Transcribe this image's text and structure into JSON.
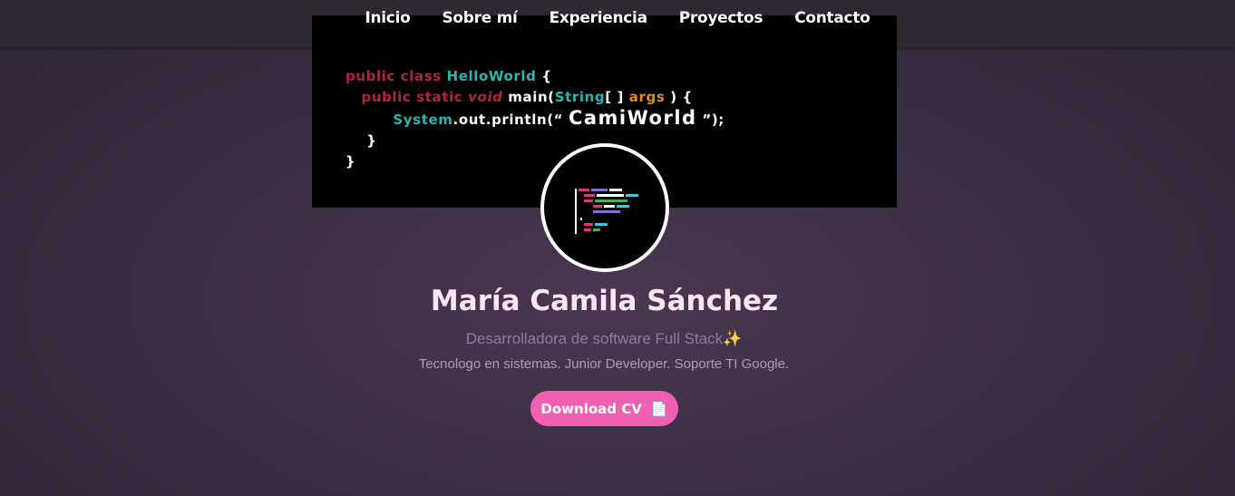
{
  "nav": {
    "items": [
      {
        "label": "Inicio"
      },
      {
        "label": "Sobre mí"
      },
      {
        "label": "Experiencia"
      },
      {
        "label": "Proyectos"
      },
      {
        "label": "Contacto"
      }
    ]
  },
  "banner": {
    "code": {
      "l1_kw": "public class ",
      "l1_cls": "HelloWorld",
      "l1_end": " {",
      "l2_kw": "public static ",
      "l2_void": "void",
      "l2_main": " main(",
      "l2_string": "String",
      "l2_brk": "[ ] ",
      "l2_args": "args",
      "l2_end": " ) {",
      "l3_system": "System",
      "l3_dot1": ".",
      "l3_out": "out",
      "l3_print": ".println(“ ",
      "l3_cami": "CamiWorld",
      "l3_end": " ”);",
      "l4": "}",
      "l5": "}"
    }
  },
  "profile": {
    "name": "María Camila Sánchez",
    "role": "Desarrolladora de software Full Stack✨",
    "description": "Tecnologo en sistemas. Junior Developer. Soporte TI Google.",
    "cv_button": "Download CV",
    "cv_icon": "📄"
  },
  "colors": {
    "accent": "#ef5fb2",
    "keyword": "#b0243e",
    "class": "#2ab5b0",
    "args": "#e38b1f"
  }
}
